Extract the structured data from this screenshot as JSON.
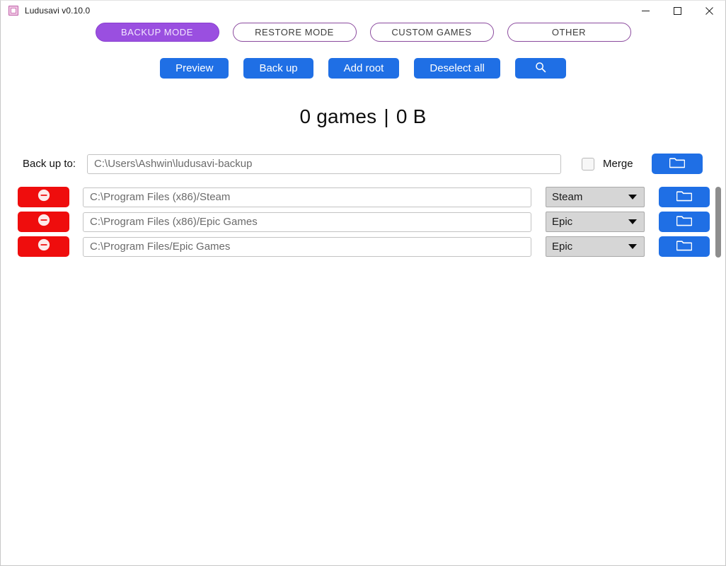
{
  "window": {
    "title": "Ludusavi v0.10.0",
    "app_icon": "app-window-icon",
    "controls": {
      "minimize": "minimize-icon",
      "maximize": "maximize-icon",
      "close": "close-icon"
    }
  },
  "modes": {
    "items": [
      {
        "label": "BACKUP MODE",
        "active": true
      },
      {
        "label": "RESTORE MODE",
        "active": false
      },
      {
        "label": "CUSTOM GAMES",
        "active": false
      },
      {
        "label": "OTHER",
        "active": false
      }
    ]
  },
  "actions": {
    "preview": "Preview",
    "back_up": "Back up",
    "add_root": "Add root",
    "deselect_all": "Deselect all",
    "search_icon": "search-icon"
  },
  "summary": {
    "games": "0 games",
    "separator": "|",
    "size": "0 B"
  },
  "backup_target": {
    "label": "Back up to:",
    "path": "C:\\Users\\Ashwin\\ludusavi-backup",
    "placeholder": "C:\\Users\\Ashwin\\ludusavi-backup",
    "merge_label": "Merge",
    "merge_checked": false,
    "folder_icon": "folder-icon"
  },
  "roots": {
    "rows": [
      {
        "path": "C:\\Program Files (x86)/Steam",
        "store": "Steam",
        "remove_icon": "minus-circle-icon",
        "folder_icon": "folder-icon"
      },
      {
        "path": "C:\\Program Files (x86)/Epic Games",
        "store": "Epic",
        "remove_icon": "minus-circle-icon",
        "folder_icon": "folder-icon"
      },
      {
        "path": "C:\\Program Files/Epic Games",
        "store": "Epic",
        "remove_icon": "minus-circle-icon",
        "folder_icon": "folder-icon"
      }
    ]
  },
  "scrollbar": {
    "name": "roots-scrollbar"
  },
  "colors": {
    "accent_blue": "#1f6fe5",
    "accent_purple": "#9a4fe0",
    "danger_red": "#ef0d0d",
    "field_border": "#c3c3c3",
    "select_bg": "#d6d6d6"
  }
}
